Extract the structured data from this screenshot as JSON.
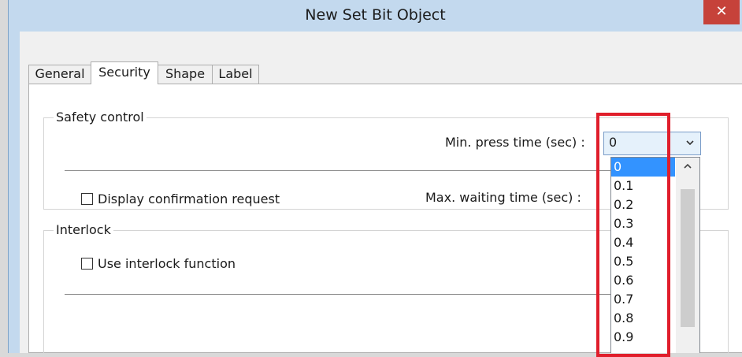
{
  "window": {
    "title": "New  Set Bit Object",
    "close_glyph": "✕"
  },
  "tabs": [
    {
      "label": "General",
      "active": false
    },
    {
      "label": "Security",
      "active": true
    },
    {
      "label": "Shape",
      "active": false
    },
    {
      "label": "Label",
      "active": false
    }
  ],
  "safety_control": {
    "group_label": "Safety control",
    "min_press_label": "Min. press time (sec) :",
    "min_press_value": "0",
    "display_confirmation_label": "Display confirmation request",
    "display_confirmation_checked": false,
    "max_waiting_label": "Max. waiting time (sec) :"
  },
  "interlock": {
    "group_label": "Interlock",
    "use_interlock_label": "Use interlock function",
    "use_interlock_checked": false
  },
  "dropdown": {
    "options": [
      "0",
      "0.1",
      "0.2",
      "0.3",
      "0.4",
      "0.5",
      "0.6",
      "0.7",
      "0.8",
      "0.9"
    ],
    "selected": "0"
  },
  "colors": {
    "title_bar": "#c3d9ee",
    "close_button": "#c6423a",
    "selection": "#3393ff",
    "highlight_box": "#e01e2b"
  },
  "icons": {
    "close": "close-icon",
    "combo_arrow": "chevron-down-icon",
    "scroll_up": "chevron-up-icon"
  }
}
